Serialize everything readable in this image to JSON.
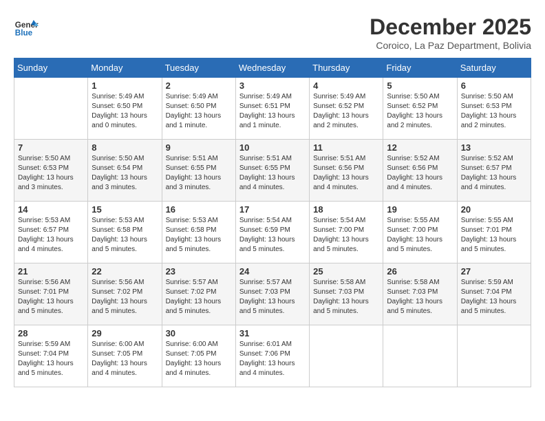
{
  "logo": {
    "name1": "General",
    "name2": "Blue"
  },
  "title": "December 2025",
  "location": "Coroico, La Paz Department, Bolivia",
  "days_of_week": [
    "Sunday",
    "Monday",
    "Tuesday",
    "Wednesday",
    "Thursday",
    "Friday",
    "Saturday"
  ],
  "weeks": [
    [
      {
        "day": "",
        "info": ""
      },
      {
        "day": "1",
        "info": "Sunrise: 5:49 AM\nSunset: 6:50 PM\nDaylight: 13 hours\nand 0 minutes."
      },
      {
        "day": "2",
        "info": "Sunrise: 5:49 AM\nSunset: 6:50 PM\nDaylight: 13 hours\nand 1 minute."
      },
      {
        "day": "3",
        "info": "Sunrise: 5:49 AM\nSunset: 6:51 PM\nDaylight: 13 hours\nand 1 minute."
      },
      {
        "day": "4",
        "info": "Sunrise: 5:49 AM\nSunset: 6:52 PM\nDaylight: 13 hours\nand 2 minutes."
      },
      {
        "day": "5",
        "info": "Sunrise: 5:50 AM\nSunset: 6:52 PM\nDaylight: 13 hours\nand 2 minutes."
      },
      {
        "day": "6",
        "info": "Sunrise: 5:50 AM\nSunset: 6:53 PM\nDaylight: 13 hours\nand 2 minutes."
      }
    ],
    [
      {
        "day": "7",
        "info": "Sunrise: 5:50 AM\nSunset: 6:53 PM\nDaylight: 13 hours\nand 3 minutes."
      },
      {
        "day": "8",
        "info": "Sunrise: 5:50 AM\nSunset: 6:54 PM\nDaylight: 13 hours\nand 3 minutes."
      },
      {
        "day": "9",
        "info": "Sunrise: 5:51 AM\nSunset: 6:55 PM\nDaylight: 13 hours\nand 3 minutes."
      },
      {
        "day": "10",
        "info": "Sunrise: 5:51 AM\nSunset: 6:55 PM\nDaylight: 13 hours\nand 4 minutes."
      },
      {
        "day": "11",
        "info": "Sunrise: 5:51 AM\nSunset: 6:56 PM\nDaylight: 13 hours\nand 4 minutes."
      },
      {
        "day": "12",
        "info": "Sunrise: 5:52 AM\nSunset: 6:56 PM\nDaylight: 13 hours\nand 4 minutes."
      },
      {
        "day": "13",
        "info": "Sunrise: 5:52 AM\nSunset: 6:57 PM\nDaylight: 13 hours\nand 4 minutes."
      }
    ],
    [
      {
        "day": "14",
        "info": "Sunrise: 5:53 AM\nSunset: 6:57 PM\nDaylight: 13 hours\nand 4 minutes."
      },
      {
        "day": "15",
        "info": "Sunrise: 5:53 AM\nSunset: 6:58 PM\nDaylight: 13 hours\nand 5 minutes."
      },
      {
        "day": "16",
        "info": "Sunrise: 5:53 AM\nSunset: 6:58 PM\nDaylight: 13 hours\nand 5 minutes."
      },
      {
        "day": "17",
        "info": "Sunrise: 5:54 AM\nSunset: 6:59 PM\nDaylight: 13 hours\nand 5 minutes."
      },
      {
        "day": "18",
        "info": "Sunrise: 5:54 AM\nSunset: 7:00 PM\nDaylight: 13 hours\nand 5 minutes."
      },
      {
        "day": "19",
        "info": "Sunrise: 5:55 AM\nSunset: 7:00 PM\nDaylight: 13 hours\nand 5 minutes."
      },
      {
        "day": "20",
        "info": "Sunrise: 5:55 AM\nSunset: 7:01 PM\nDaylight: 13 hours\nand 5 minutes."
      }
    ],
    [
      {
        "day": "21",
        "info": "Sunrise: 5:56 AM\nSunset: 7:01 PM\nDaylight: 13 hours\nand 5 minutes."
      },
      {
        "day": "22",
        "info": "Sunrise: 5:56 AM\nSunset: 7:02 PM\nDaylight: 13 hours\nand 5 minutes."
      },
      {
        "day": "23",
        "info": "Sunrise: 5:57 AM\nSunset: 7:02 PM\nDaylight: 13 hours\nand 5 minutes."
      },
      {
        "day": "24",
        "info": "Sunrise: 5:57 AM\nSunset: 7:03 PM\nDaylight: 13 hours\nand 5 minutes."
      },
      {
        "day": "25",
        "info": "Sunrise: 5:58 AM\nSunset: 7:03 PM\nDaylight: 13 hours\nand 5 minutes."
      },
      {
        "day": "26",
        "info": "Sunrise: 5:58 AM\nSunset: 7:03 PM\nDaylight: 13 hours\nand 5 minutes."
      },
      {
        "day": "27",
        "info": "Sunrise: 5:59 AM\nSunset: 7:04 PM\nDaylight: 13 hours\nand 5 minutes."
      }
    ],
    [
      {
        "day": "28",
        "info": "Sunrise: 5:59 AM\nSunset: 7:04 PM\nDaylight: 13 hours\nand 5 minutes."
      },
      {
        "day": "29",
        "info": "Sunrise: 6:00 AM\nSunset: 7:05 PM\nDaylight: 13 hours\nand 4 minutes."
      },
      {
        "day": "30",
        "info": "Sunrise: 6:00 AM\nSunset: 7:05 PM\nDaylight: 13 hours\nand 4 minutes."
      },
      {
        "day": "31",
        "info": "Sunrise: 6:01 AM\nSunset: 7:06 PM\nDaylight: 13 hours\nand 4 minutes."
      },
      {
        "day": "",
        "info": ""
      },
      {
        "day": "",
        "info": ""
      },
      {
        "day": "",
        "info": ""
      }
    ]
  ]
}
